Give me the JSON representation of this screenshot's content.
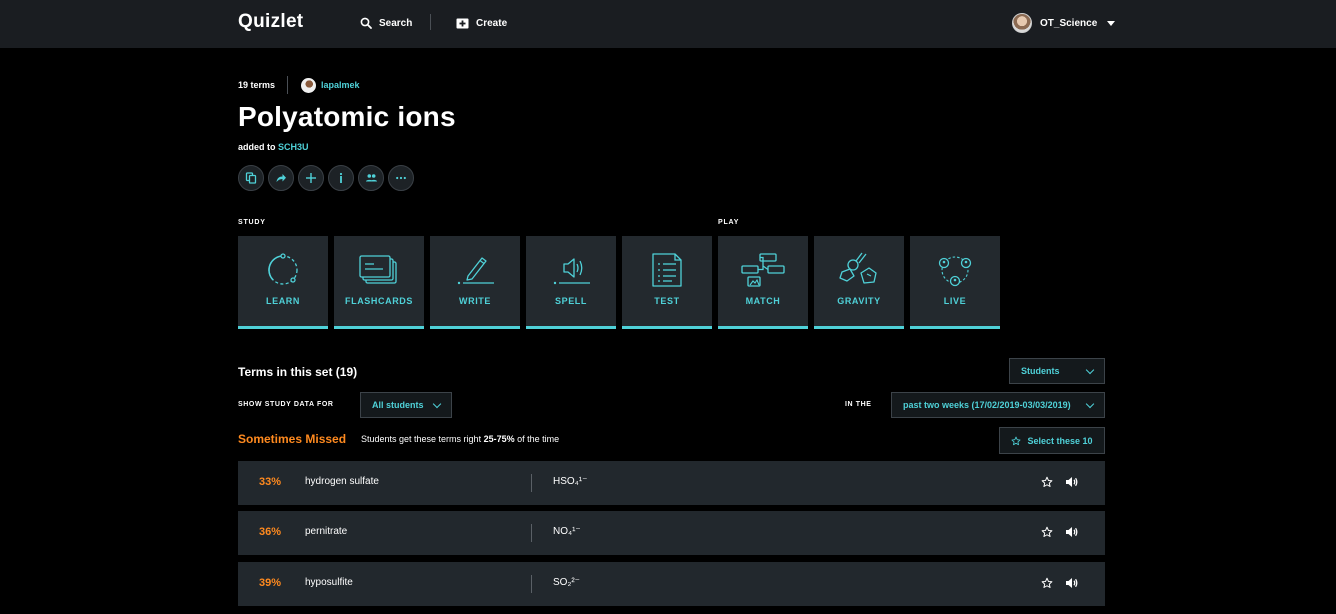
{
  "app": {
    "logo": "Quizlet",
    "nav": {
      "search_label": "Search",
      "create_label": "Create"
    },
    "user": {
      "name": "OT_Science"
    }
  },
  "set": {
    "term_count": "19 terms",
    "author": "lapalmek",
    "title": "Polyatomic ions",
    "added_prefix": "added to",
    "added_class": "SCH3U",
    "actions": [
      "copy-icon",
      "share-icon",
      "add-icon",
      "info-icon",
      "group-icon",
      "more-icon"
    ]
  },
  "study": {
    "study_label": "STUDY",
    "play_label": "PLAY",
    "modes": [
      {
        "label": "LEARN",
        "icon": "learn-icon"
      },
      {
        "label": "FLASHCARDS",
        "icon": "flashcards-icon"
      },
      {
        "label": "WRITE",
        "icon": "write-icon"
      },
      {
        "label": "SPELL",
        "icon": "spell-icon"
      },
      {
        "label": "TEST",
        "icon": "test-icon"
      },
      {
        "label": "MATCH",
        "icon": "match-icon"
      },
      {
        "label": "GRAVITY",
        "icon": "gravity-icon"
      },
      {
        "label": "LIVE",
        "icon": "live-icon"
      }
    ]
  },
  "terms": {
    "title": "Terms in this set (19)",
    "view_dropdown": "Students",
    "show_label": "SHOW STUDY DATA FOR",
    "filter_dropdown": "All students",
    "in_the_label": "IN THE",
    "period_dropdown": "past two weeks (17/02/2019-03/03/2019)",
    "missed_title": "Sometimes Missed",
    "missed_desc_prefix": "Students get these terms right",
    "missed_desc_range": "25-75%",
    "missed_desc_suffix": "of the time",
    "select_button": "Select these 10",
    "rows": [
      {
        "pct": "33%",
        "term": "hydrogen sulfate",
        "definition": "HSO₄¹⁻"
      },
      {
        "pct": "36%",
        "term": "pernitrate",
        "definition": "NO₄¹⁻"
      },
      {
        "pct": "39%",
        "term": "hyposulfite",
        "definition": "SO₂²⁻"
      }
    ]
  },
  "colors": {
    "accent": "#4fd1d8",
    "warning": "#ff8a1f",
    "card": "#22282d",
    "topbar": "#1a1d21"
  }
}
